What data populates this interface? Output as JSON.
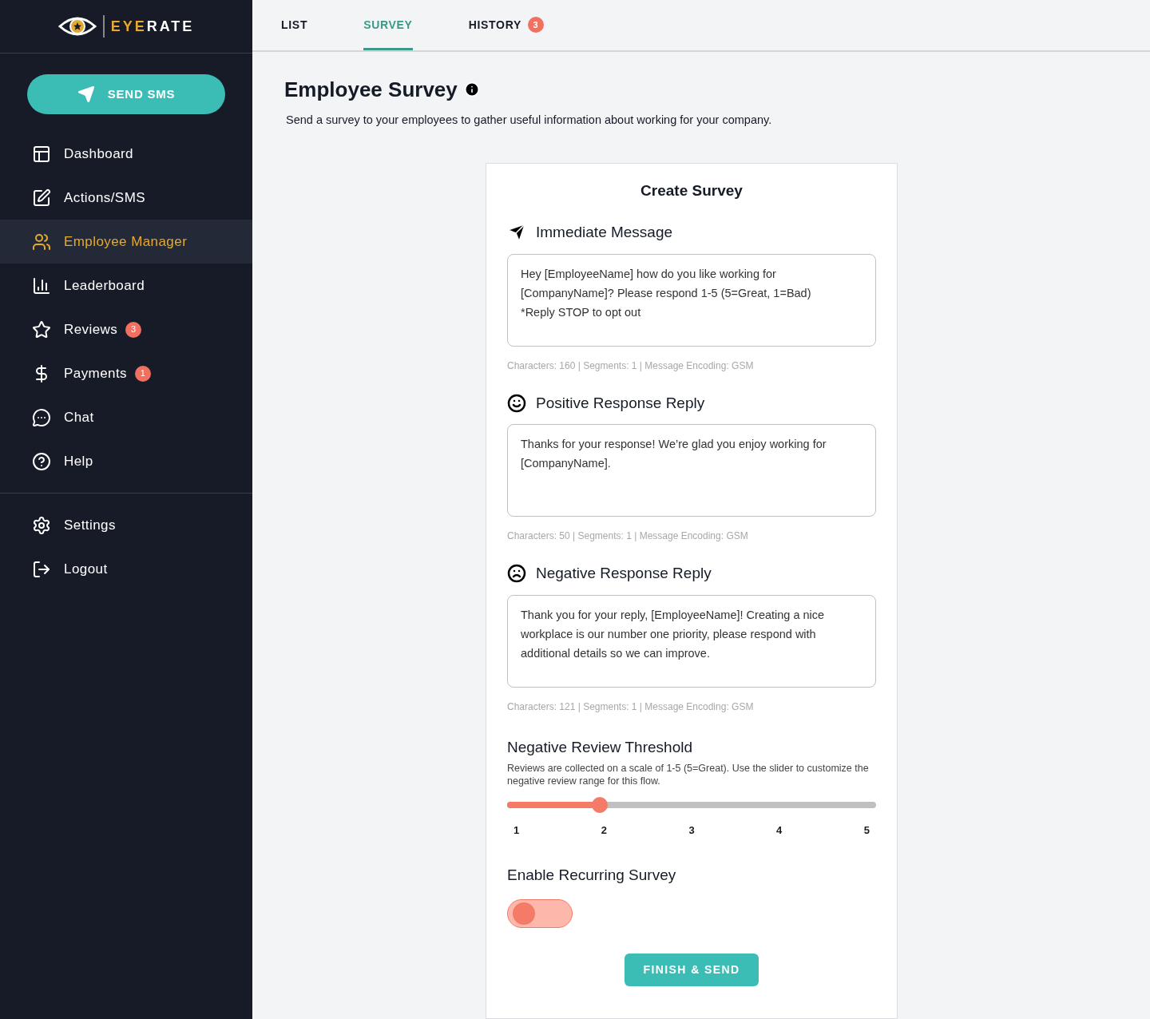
{
  "logo": {
    "part_1": "EYE",
    "part_2": "RATE"
  },
  "sidebar": {
    "action_button": "SEND SMS",
    "items": [
      {
        "label": "Dashboard",
        "selected": false
      },
      {
        "label": "Actions/SMS",
        "selected": false
      },
      {
        "label": "Employee Manager",
        "selected": true
      },
      {
        "label": "Leaderboard",
        "selected": false
      },
      {
        "label": "Reviews",
        "selected": false,
        "badge": "3"
      },
      {
        "label": "Payments",
        "selected": false,
        "badge": "1"
      },
      {
        "label": "Chat",
        "selected": false
      },
      {
        "label": "Help",
        "selected": false
      }
    ],
    "bottom_items": [
      {
        "label": "Settings",
        "selected": false
      },
      {
        "label": "Logout",
        "selected": false
      }
    ]
  },
  "tabs": [
    {
      "label": "LIST",
      "selected": false
    },
    {
      "label": "SURVEY",
      "selected": true
    },
    {
      "label": "HISTORY",
      "selected": false,
      "badge": "3"
    }
  ],
  "page": {
    "title": "Employee Survey",
    "subtitle": "Send a survey to your employees to gather useful information about working for your company."
  },
  "card": {
    "title": "Create Survey",
    "messages": [
      {
        "heading": "Immediate Message",
        "value": "Hey [EmployeeName] how do you like working for [CompanyName]? Please respond 1-5 (5=Great, 1=Bad)\n*Reply STOP to opt out",
        "stats": "Characters: 160 | Segments: 1 | Message Encoding: GSM"
      },
      {
        "heading": "Positive Response Reply",
        "value": "Thanks for your response! We’re glad you enjoy working for [CompanyName].",
        "stats": "Characters: 50 | Segments: 1 | Message Encoding: GSM"
      },
      {
        "heading": "Negative Response Reply",
        "value": "Thank you for your reply, [EmployeeName]! Creating a nice workplace is our number one priority, please respond with additional details so we can improve.",
        "stats": "Characters: 121 | Segments: 1 | Message Encoding: GSM"
      }
    ],
    "threshold": {
      "heading": "Negative Review Threshold",
      "description": "Reviews are collected on a scale of 1-5 (5=Great). Use the slider to customize the negative review range for this flow.",
      "level": 0.25,
      "ticks": [
        "1",
        "2",
        "3",
        "4",
        "5"
      ]
    },
    "recurring": {
      "heading": "Enable Recurring Survey",
      "on": false
    },
    "submit_button": "FINISH & SEND"
  }
}
